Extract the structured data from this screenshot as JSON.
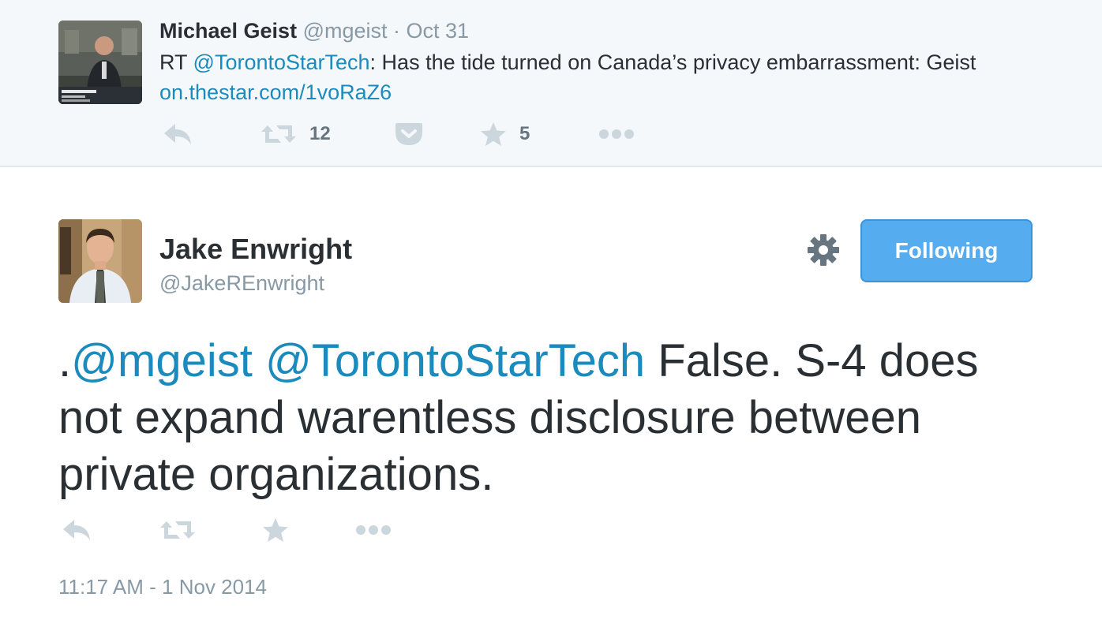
{
  "parent_tweet": {
    "name": "Michael Geist",
    "handle": "@mgeist",
    "separator": " · ",
    "date": "Oct 31",
    "text_prefix": "RT ",
    "mention": "@TorontoStarTech",
    "text_body": ": Has the tide turned on Canada’s privacy embarrassment: Geist ",
    "link": "on.thestar.com/1voRaZ6",
    "actions": {
      "reply_icon": "reply-icon",
      "retweet_icon": "retweet-icon",
      "retweet_count": "12",
      "pocket_icon": "pocket-icon",
      "favorite_icon": "star-icon",
      "favorite_count": "5",
      "more_icon": "more-dots-icon"
    }
  },
  "main_tweet": {
    "name": "Jake Enwright",
    "handle": "@JakeREnwright",
    "gear_icon": "gear-icon",
    "follow_button": "Following",
    "text_lead": ".",
    "mention_1": "@mgeist",
    "space": " ",
    "mention_2": "@TorontoStarTech",
    "text_body": " False. S-4 does not expand warentless disclosure between private organizations.",
    "actions": {
      "reply_icon": "reply-icon",
      "retweet_icon": "retweet-icon",
      "favorite_icon": "star-icon",
      "more_icon": "more-dots-icon"
    },
    "timestamp": "11:17 AM - 1 Nov 2014"
  },
  "colors": {
    "link": "#1b8bbd",
    "muted": "#8899a6",
    "text": "#292f33",
    "button": "#55acee",
    "parent_bg": "#f5f8fa"
  }
}
